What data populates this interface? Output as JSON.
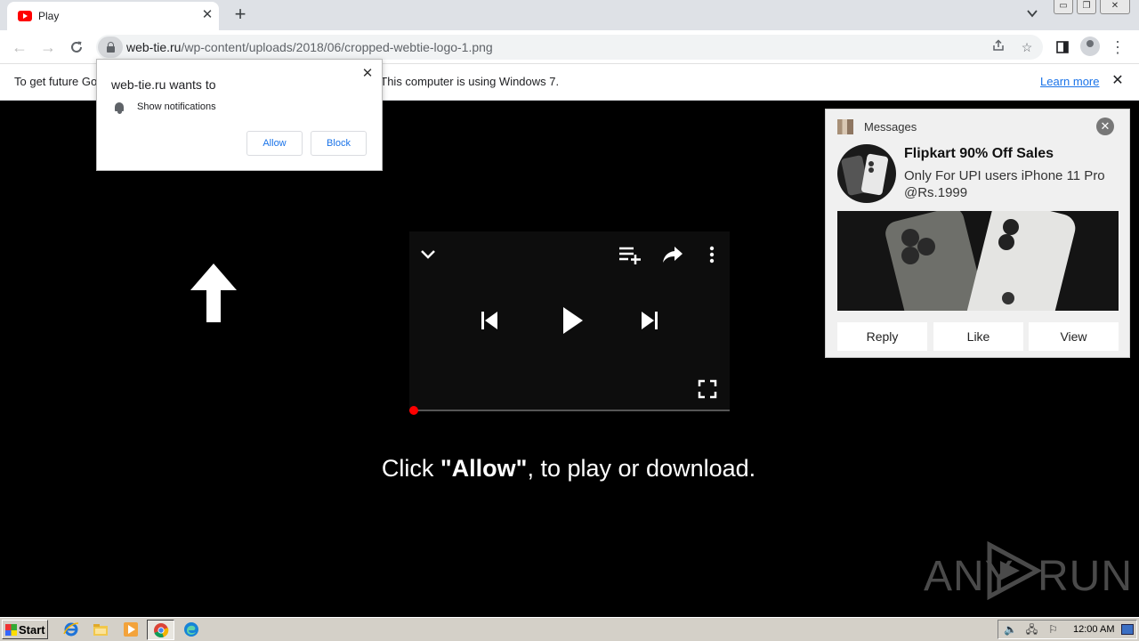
{
  "browser": {
    "tab_title": "Play",
    "new_tab_symbol": "+",
    "url_host": "web-tie.ru",
    "url_path": "/wp-content/uploads/2018/06/cropped-webtie-logo-1.png"
  },
  "infobar": {
    "text": "To get future Google Chrome updates, you'll need Windows 10 or later. This computer is using Windows 7.",
    "link": "Learn more"
  },
  "permission": {
    "title": "web-tie.ru wants to",
    "item": "Show notifications",
    "allow_label": "Allow",
    "block_label": "Block"
  },
  "page": {
    "headline_pre": "Click ",
    "headline_bold": "\"Allow\"",
    "headline_post": ", to play or download."
  },
  "notification": {
    "app_name": "Messages",
    "title": "Flipkart 90% Off Sales",
    "body": "Only For UPI users iPhone 11 Pro @Rs.1999",
    "actions": [
      "Reply",
      "Like",
      "View"
    ]
  },
  "watermark": {
    "left": "ANY",
    "right": "RUN"
  },
  "taskbar": {
    "start_label": "Start",
    "clock": "12:00 AM"
  },
  "colors": {
    "accent": "#1a73e8",
    "youtube_red": "#ff0000",
    "progress_red": "#ff0000"
  },
  "icons": [
    "youtube-icon",
    "lock-icon",
    "bell-icon",
    "chevron-down-icon",
    "playlist-add-icon",
    "share-icon",
    "more-vert-icon",
    "skip-previous-icon",
    "play-icon",
    "skip-next-icon",
    "fullscreen-icon",
    "arrow-up-icon"
  ]
}
